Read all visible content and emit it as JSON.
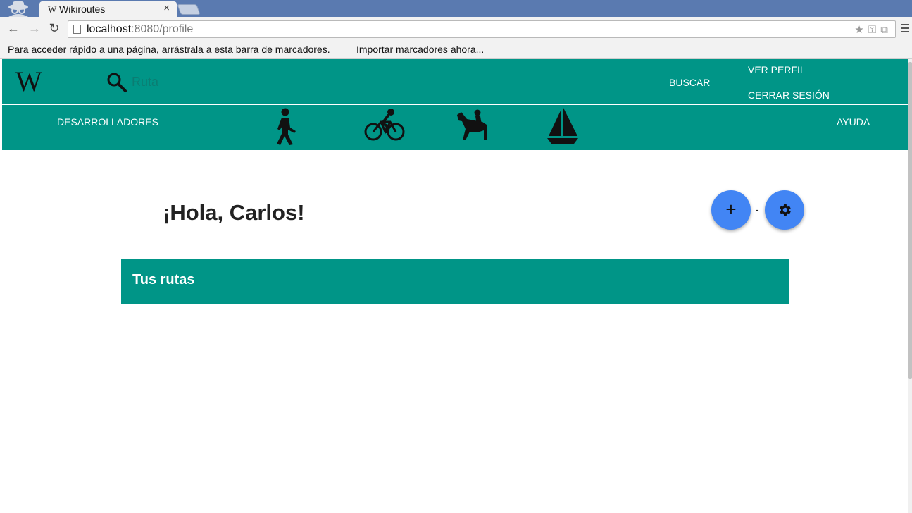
{
  "browser": {
    "tab_title": "Wikiroutes",
    "tab_favicon": "W",
    "url_host": "localhost",
    "url_rest": ":8080/profile",
    "bookmarks_text": "Para acceder rápido a una página, arrástrala a esta barra de marcadores.",
    "bookmarks_link": "Importar marcadores ahora..."
  },
  "header": {
    "logo": "W",
    "search_placeholder": "Ruta",
    "search_button": "BUSCAR",
    "view_profile": "VER PERFIL",
    "logout": "CERRAR SESIÓN"
  },
  "subnav": {
    "developers": "DESARROLLADORES",
    "help": "AYUDA",
    "icons": [
      "walking-icon",
      "cycling-icon",
      "horse-riding-icon",
      "sailing-icon"
    ]
  },
  "profile": {
    "greeting": "¡Hola, Carlos!",
    "add_label": "+",
    "separator": "-",
    "routes_title": "Tus rutas"
  },
  "colors": {
    "primary": "#009587",
    "fab": "#4285f4"
  }
}
